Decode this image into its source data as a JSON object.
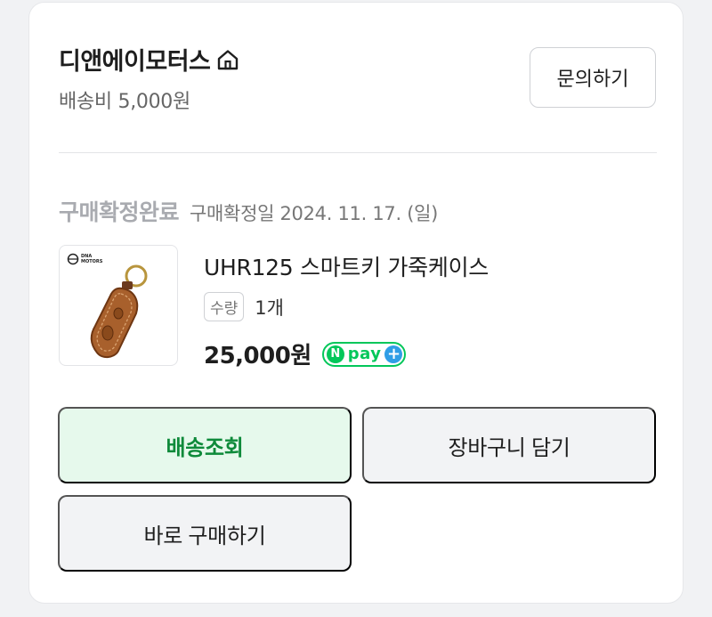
{
  "store": {
    "name": "디앤에이모터스",
    "shipping": "배송비 5,000원",
    "inquiry_label": "문의하기"
  },
  "order": {
    "status": "구매확정완료",
    "confirmed_date": "구매확정일 2024. 11. 17. (일)"
  },
  "product": {
    "thumbnail_logo": "DNA MOTORS",
    "name": "UHR125 스마트키 가죽케이스",
    "qty_label": "수량",
    "qty_value": "1개",
    "price": "25,000원",
    "npay": {
      "n": "N",
      "text": "pay",
      "plus": "+"
    }
  },
  "actions": {
    "track": "배송조회",
    "cart": "장바구니 담기",
    "buy_now": "바로 구매하기"
  },
  "colors": {
    "accent_green": "#03c75a",
    "track_bg": "#e6f9ec",
    "track_text": "#0e8a3a",
    "npay_plus": "#2f9ee6"
  },
  "icons": [
    "home-icon",
    "npay-badge"
  ]
}
